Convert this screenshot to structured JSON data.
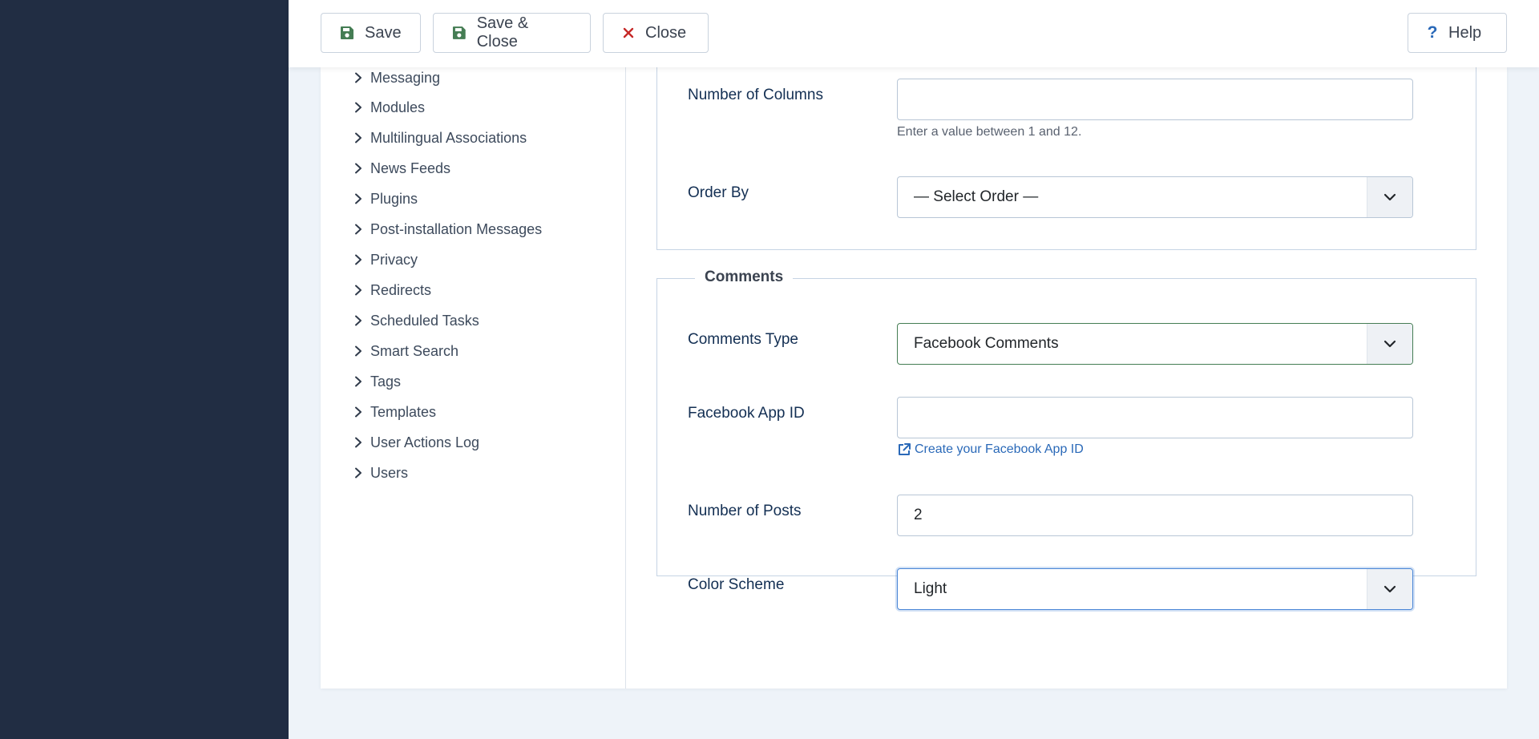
{
  "toolbar": {
    "save_label": "Save",
    "save_close_label": "Save & Close",
    "close_label": "Close",
    "help_label": "Help"
  },
  "sidebar": {
    "items": [
      {
        "label": "Messaging"
      },
      {
        "label": "Modules"
      },
      {
        "label": "Multilingual Associations"
      },
      {
        "label": "News Feeds"
      },
      {
        "label": "Plugins"
      },
      {
        "label": "Post-installation Messages"
      },
      {
        "label": "Privacy"
      },
      {
        "label": "Redirects"
      },
      {
        "label": "Scheduled Tasks"
      },
      {
        "label": "Smart Search"
      },
      {
        "label": "Tags"
      },
      {
        "label": "Templates"
      },
      {
        "label": "User Actions Log"
      },
      {
        "label": "Users"
      }
    ]
  },
  "layout_section": {
    "columns_label": "Number of Columns",
    "columns_value": "",
    "columns_hint": "Enter a value between 1 and 12.",
    "order_label": "Order By",
    "order_value": "— Select Order —"
  },
  "comments": {
    "legend": "Comments",
    "type_label": "Comments Type",
    "type_value": "Facebook Comments",
    "app_id_label": "Facebook App ID",
    "app_id_value": "",
    "app_id_link": "Create your Facebook App ID",
    "posts_label": "Number of Posts",
    "posts_value": "2",
    "scheme_label": "Color Scheme",
    "scheme_value": "Light"
  },
  "colors": {
    "sidebar_bg": "#212d43",
    "page_bg": "#eef3f9",
    "label_text": "#132f53",
    "save_icon": "#457d54",
    "close_icon": "#c52827",
    "help_icon": "#2a69b8",
    "link": "#2a69b8"
  },
  "icons": {
    "save": "floppy-disk-icon",
    "close": "x-mark-icon",
    "help": "question-mark-icon",
    "chevron": "chevron-right-icon",
    "external": "external-link-icon",
    "caret": "chevron-down-icon"
  }
}
